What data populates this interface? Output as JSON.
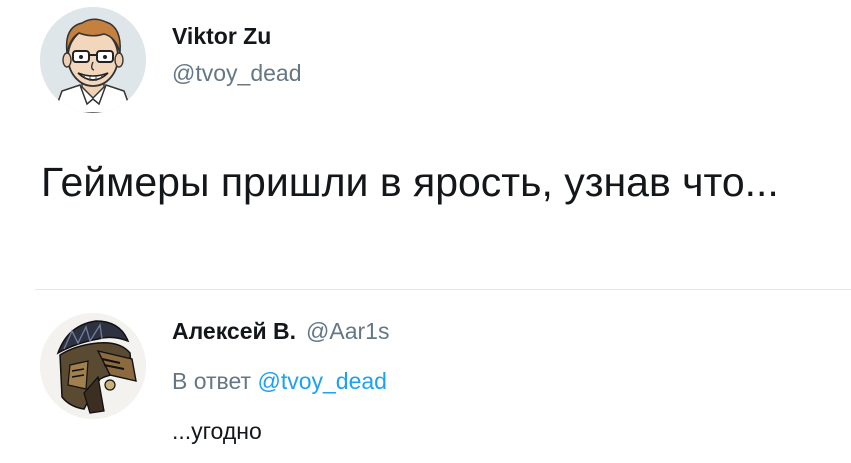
{
  "main_tweet": {
    "author": {
      "display_name": "Viktor Zu",
      "handle": "@tvoy_dead",
      "avatar_icon": "cartoon-man-with-glasses-avatar"
    },
    "text": "Геймеры пришли в ярость, узнав что..."
  },
  "reply_tweet": {
    "author": {
      "display_name": "Алексей В.",
      "handle": "@Aar1s",
      "avatar_icon": "dark-creature-art-avatar"
    },
    "reply_prefix": "В ответ",
    "reply_mention": "@tvoy_dead",
    "text": "...угодно"
  },
  "colors": {
    "text_primary": "#14171a",
    "text_secondary": "#657786",
    "link": "#1da1f2",
    "divider": "#e1e8ed"
  }
}
